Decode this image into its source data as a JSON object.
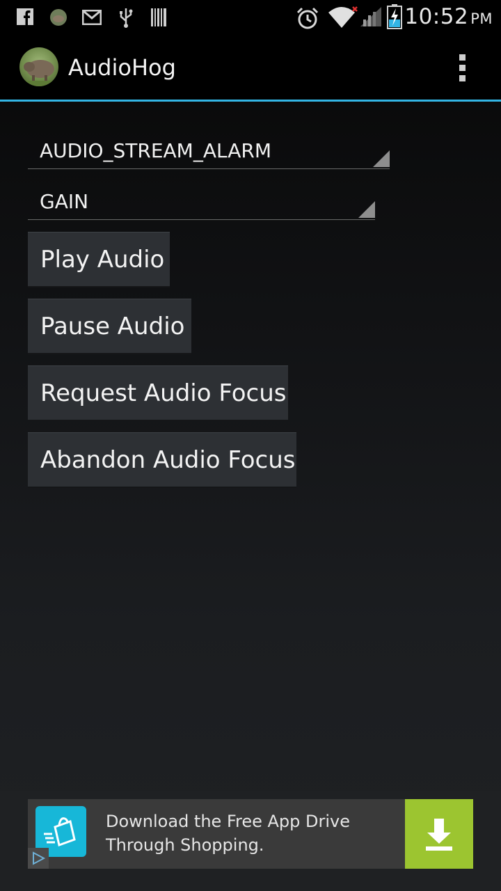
{
  "status_bar": {
    "time": "10:52",
    "ampm": "PM",
    "left_icons": [
      "facebook-icon",
      "avatar-icon",
      "gmail-icon",
      "usb-icon",
      "barcode-icon"
    ],
    "right_icons": [
      "alarm-icon",
      "wifi-icon",
      "signal-icon",
      "battery-charging-icon"
    ]
  },
  "action_bar": {
    "title": "AudioHog",
    "accent_color": "#33b5e5",
    "overflow_icon": "overflow-menu-icon"
  },
  "spinners": {
    "stream": {
      "selected": "AUDIO_STREAM_ALARM"
    },
    "focus_type": {
      "selected": "GAIN"
    }
  },
  "buttons": {
    "play": "Play Audio",
    "pause": "Pause Audio",
    "request_focus": "Request Audio Focus",
    "abandon_focus": "Abandon Audio Focus"
  },
  "ad": {
    "line1": "Download the Free App Drive",
    "line2": "Through Shopping.",
    "app_icon": "shopping-bag-icon",
    "download_icon": "download-icon",
    "adchoices_icon": "adchoices-icon",
    "download_color": "#9cc530",
    "icon_color": "#17b7d8"
  }
}
